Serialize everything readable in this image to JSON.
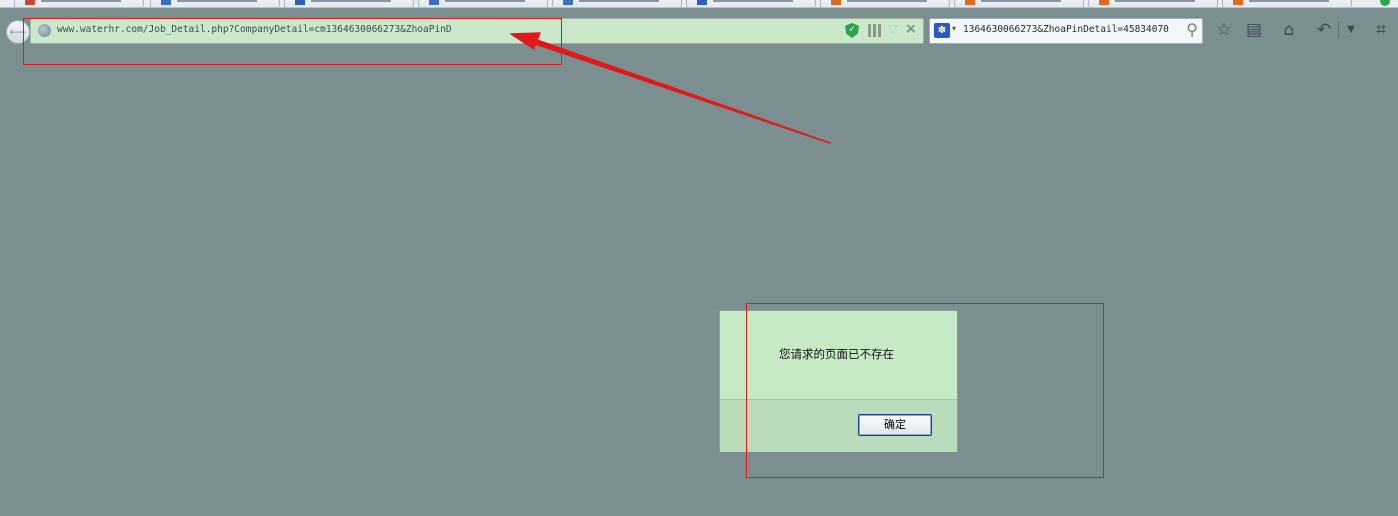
{
  "browser": {
    "tabs": [
      {
        "icon": "red-favicon-icon"
      },
      {
        "icon": "page-favicon-icon"
      },
      {
        "icon": "blue-favicon-icon"
      },
      {
        "icon": "page-favicon-icon"
      },
      {
        "icon": "page-favicon-icon"
      },
      {
        "icon": "blue-favicon-icon"
      },
      {
        "icon": "orange-favicon-icon"
      },
      {
        "icon": "orange-favicon-icon"
      },
      {
        "icon": "orange-favicon-icon"
      },
      {
        "icon": "orange-favicon-icon"
      }
    ],
    "back_glyph": "⟵",
    "url": "www.waterhr.com/Job_Detail.php?CompanyDetail=cm1364630066273&ZhoaPinD",
    "search_query": "1364630066273&ZhoaPinDetail=45834070",
    "toolbar_icons": [
      "star-icon",
      "reading-list-icon",
      "home-icon",
      "undo-icon",
      "menu-dropdown-icon",
      "crop-icon"
    ]
  },
  "dialog": {
    "message": "您请求的页面已不存在",
    "ok_label": "确定"
  },
  "annotations": {
    "color": "#e0191b"
  },
  "colors": {
    "page_background": "#7b8f90",
    "urlbar_background": "#cbe8cb",
    "dialog_background": "#c6e9c6"
  }
}
